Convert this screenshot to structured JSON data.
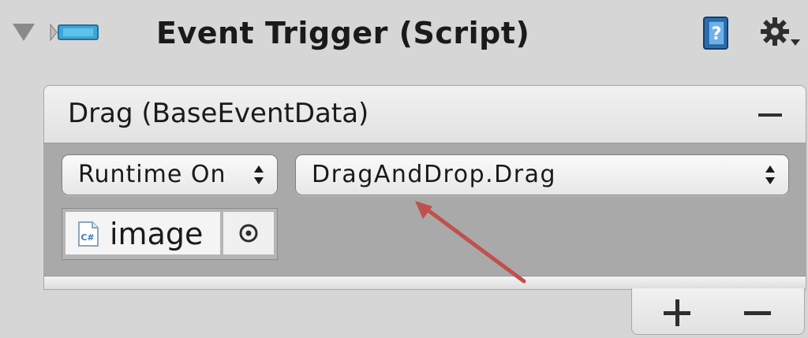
{
  "component": {
    "title": "Event Trigger (Script)",
    "icons": [
      "foldout-arrow-icon",
      "script-component-icon",
      "help-book-icon",
      "gear-icon"
    ]
  },
  "event": {
    "label": "Drag (BaseEventData)",
    "call": {
      "mode": "Runtime On",
      "method": "DragAndDrop.Drag",
      "target_label": "image",
      "target_icon": "csharp-script-icon"
    }
  },
  "footer": {
    "add_icon": "plus-icon",
    "remove_icon": "minus-icon"
  },
  "annotation": {
    "color": "#c0504d",
    "points_to": "method-dropdown"
  },
  "colors": {
    "panel_bg": "#d6d6d6",
    "event_body_bg": "#a9a9a9",
    "help_icon_blue": "#2a6fb3"
  }
}
